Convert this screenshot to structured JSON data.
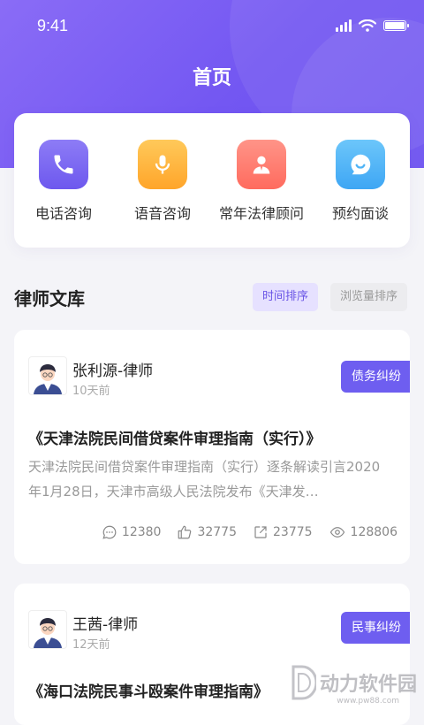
{
  "status_bar": {
    "time": "9:41"
  },
  "header": {
    "title": "首页"
  },
  "quick_actions": [
    {
      "label": "电话咨询",
      "icon": "phone-icon",
      "color": "#7b67f0"
    },
    {
      "label": "语音咨询",
      "icon": "microphone-icon",
      "color": "#ffb53a"
    },
    {
      "label": "常年法律顾问",
      "icon": "lawyer-icon",
      "color": "#ff7a6c"
    },
    {
      "label": "预约面谈",
      "icon": "chat-icon",
      "color": "#4fb4f6"
    }
  ],
  "library": {
    "title": "律师文库",
    "sort_time": "时间排序",
    "sort_views": "浏览量排序"
  },
  "articles": [
    {
      "author": "张利源-律师",
      "time": "10天前",
      "tag": "债务纠纷",
      "title": "《天津法院民间借贷案件审理指南（实行）》",
      "desc": "天津法院民间借贷案件审理指南（实行）逐条解读引言2020年1月28日，天津市高级人民法院发布《天津发…",
      "comments": "12380",
      "likes": "32775",
      "shares": "23775",
      "views": "128806"
    },
    {
      "author": "王茜-律师",
      "time": "12天前",
      "tag": "民事纠纷",
      "title": "《海口法院民事斗殴案件审理指南》"
    }
  ],
  "watermark": {
    "text": "动力软件园",
    "url": "www.pw88.com"
  },
  "colors": {
    "primary": "#7357f2",
    "tag": "#6e5ef0"
  }
}
